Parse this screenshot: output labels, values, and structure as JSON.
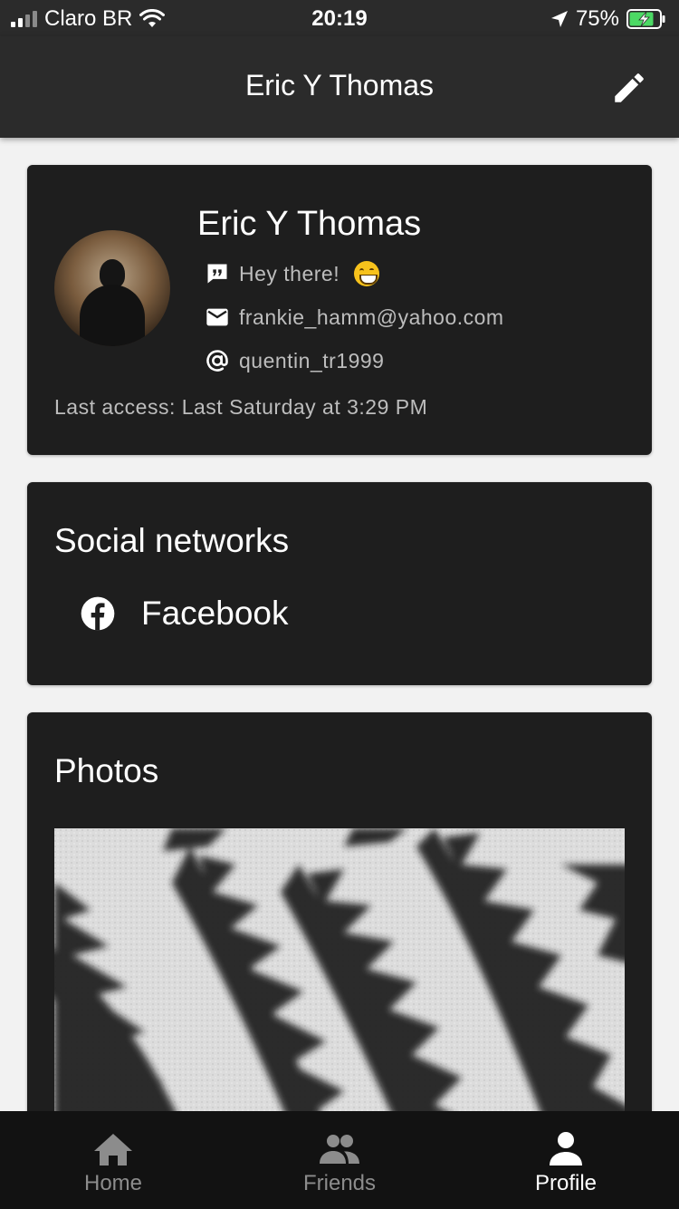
{
  "status_bar": {
    "carrier": "Claro BR",
    "time": "20:19",
    "battery_percent": "75%"
  },
  "app_bar": {
    "title": "Eric Y Thomas"
  },
  "profile": {
    "name": "Eric Y Thomas",
    "status_message": "Hey there!",
    "email": "frankie_hamm@yahoo.com",
    "username": "quentin_tr1999",
    "last_access": "Last access: Last Saturday at 3:29 PM"
  },
  "social": {
    "title": "Social networks",
    "items": [
      {
        "label": "Facebook"
      }
    ]
  },
  "photos": {
    "title": "Photos"
  },
  "bottom_nav": {
    "items": [
      {
        "label": "Home",
        "icon": "home-icon"
      },
      {
        "label": "Friends",
        "icon": "people-icon"
      },
      {
        "label": "Profile",
        "icon": "person-icon"
      }
    ],
    "active": "Profile"
  },
  "colors": {
    "bar_bg": "#2b2b2b",
    "card_bg": "#1e1e1e",
    "page_bg": "#f2f2f2",
    "nav_bg": "#121212",
    "battery_green": "#4cd964"
  }
}
